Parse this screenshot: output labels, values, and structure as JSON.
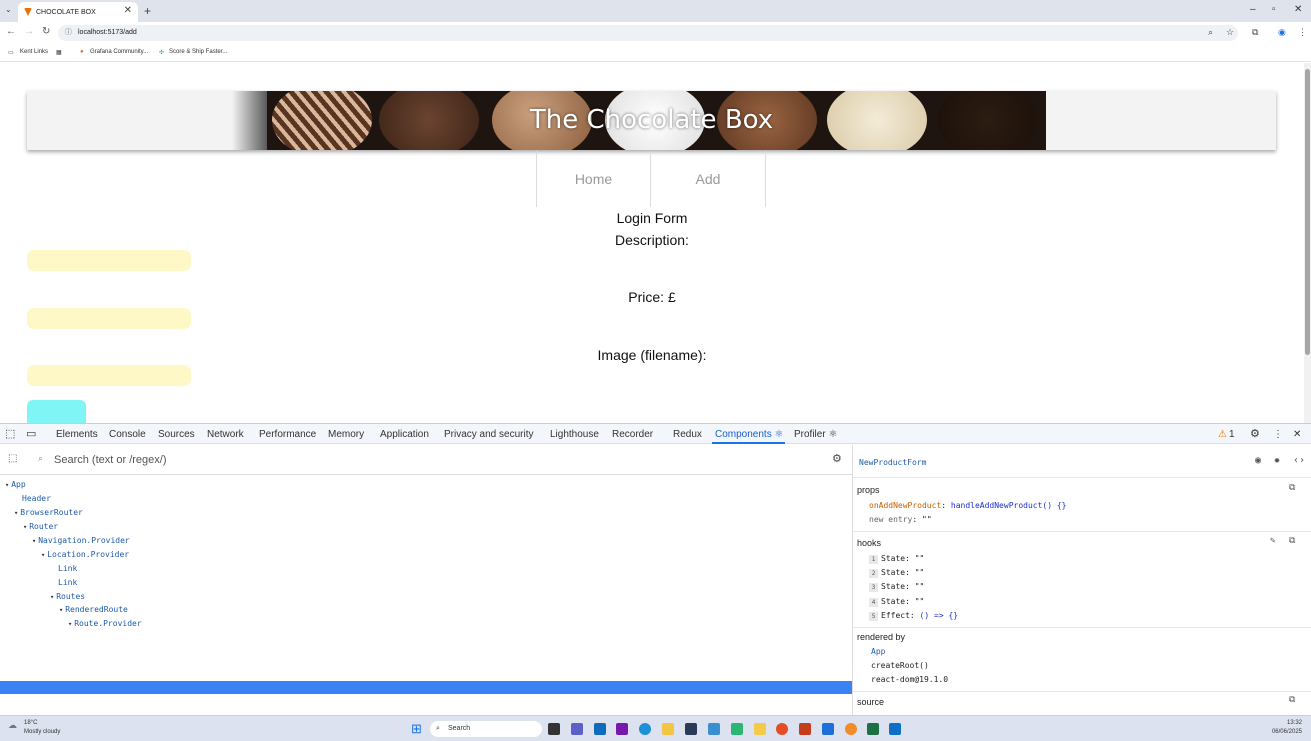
{
  "browser": {
    "tab_title": "CHOCOLATE BOX",
    "url": "localhost:5173/add",
    "bookmarks": [
      "Kent Links",
      "Grafana Community...",
      "Score & Ship Faster..."
    ]
  },
  "page": {
    "banner_title": "The Chocolate Box",
    "nav": {
      "home": "Home",
      "add": "Add"
    },
    "form": {
      "heading": "Login Form",
      "description_label": "Description:",
      "price_label": "Price: £",
      "image_label": "Image (filename):"
    }
  },
  "devtools": {
    "tabs": [
      "Elements",
      "Console",
      "Sources",
      "Network",
      "Performance",
      "Memory",
      "Application",
      "Privacy and security",
      "Lighthouse",
      "Recorder",
      "Redux",
      "Components ⚛",
      "Profiler ⚛"
    ],
    "active_tab": "Components ⚛",
    "warning_count": "1",
    "search_placeholder": "Search (text or /regex/)",
    "tree": [
      {
        "label": "App",
        "depth": 0,
        "expanded": true
      },
      {
        "label": "Header",
        "depth": 1,
        "expanded": false
      },
      {
        "label": "BrowserRouter",
        "depth": 1,
        "expanded": true
      },
      {
        "label": "Router",
        "depth": 2,
        "expanded": true
      },
      {
        "label": "Navigation.Provider",
        "depth": 3,
        "expanded": true
      },
      {
        "label": "Location.Provider",
        "depth": 4,
        "expanded": true
      },
      {
        "label": "Link",
        "depth": 5,
        "expanded": false
      },
      {
        "label": "Link",
        "depth": 5,
        "expanded": false
      },
      {
        "label": "Routes",
        "depth": 5,
        "expanded": true
      },
      {
        "label": "RenderedRoute",
        "depth": 6,
        "expanded": true
      },
      {
        "label": "Route.Provider",
        "depth": 7,
        "expanded": true
      },
      {
        "label": "NewProductForm",
        "depth": 8,
        "expanded": false,
        "selected": true
      }
    ],
    "inspector": {
      "component": "NewProductForm",
      "props_title": "props",
      "props": [
        {
          "key": "onAddNewProduct",
          "value": "handleAddNewProduct() {}"
        },
        {
          "key": "new entry",
          "value": "\"\""
        }
      ],
      "hooks_title": "hooks",
      "hooks": [
        {
          "n": "1",
          "name": "State",
          "value": "\"\""
        },
        {
          "n": "2",
          "name": "State",
          "value": "\"\""
        },
        {
          "n": "3",
          "name": "State",
          "value": "\"\""
        },
        {
          "n": "4",
          "name": "State",
          "value": "\"\""
        },
        {
          "n": "5",
          "name": "Effect",
          "value": "() => {}"
        }
      ],
      "rendered_by_title": "rendered by",
      "rendered_by": [
        "App",
        "createRoot()",
        "react-dom@19.1.0"
      ],
      "source_title": "source"
    }
  },
  "taskbar": {
    "weather_temp": "18°C",
    "weather_desc": "Mostly cloudy",
    "search": "Search",
    "time": "13:32",
    "date": "06/06/2025"
  }
}
